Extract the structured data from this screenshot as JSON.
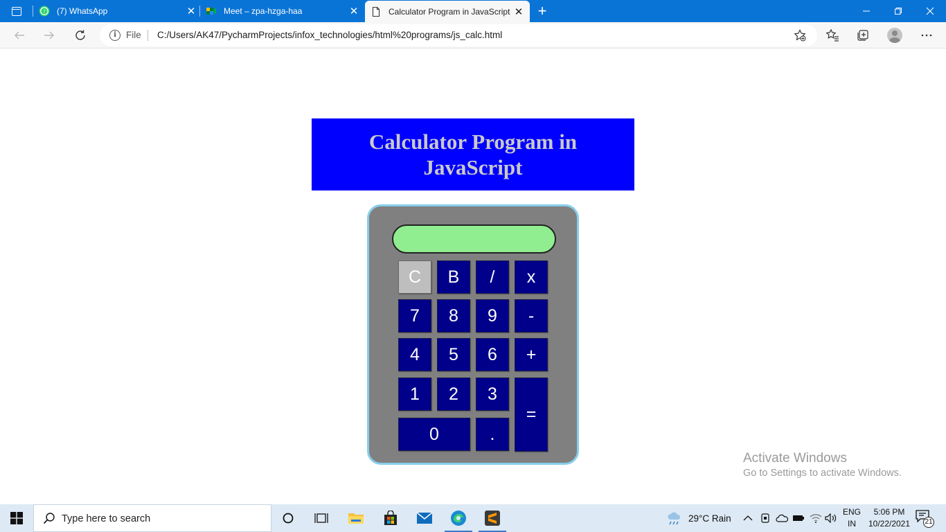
{
  "browser": {
    "tabs": [
      {
        "label": "(7) WhatsApp",
        "favicon": "whatsapp-icon"
      },
      {
        "label": "Meet – zpa-hzga-haa",
        "favicon": "google-meet-icon"
      },
      {
        "label": "Calculator Program in JavaScript",
        "favicon": "page-icon",
        "active": true
      }
    ],
    "address": {
      "scheme_label": "File",
      "url": "C:/Users/AK47/PycharmProjects/infox_technologies/html%20programs/js_calc.html"
    }
  },
  "page": {
    "heading": "Calculator Program in JavaScript",
    "calculator": {
      "display_value": "",
      "keys": {
        "clear": "C",
        "back": "B",
        "divide": "/",
        "multiply": "x",
        "seven": "7",
        "eight": "8",
        "nine": "9",
        "minus": "-",
        "four": "4",
        "five": "5",
        "six": "6",
        "plus": "+",
        "one": "1",
        "two": "2",
        "three": "3",
        "equals": "=",
        "zero": "0",
        "dot": "."
      }
    }
  },
  "watermark": {
    "line1": "Activate Windows",
    "line2": "Go to Settings to activate Windows."
  },
  "taskbar": {
    "search_placeholder": "Type here to search",
    "weather": "29°C  Rain",
    "lang_top": "ENG",
    "lang_bottom": "IN",
    "time": "5:06 PM",
    "date": "10/22/2021",
    "notification_count": "21"
  },
  "colors": {
    "titlebar": "#0a74d6",
    "heading_bg": "#0000ff",
    "heading_text": "#c9c9c9",
    "calc_body": "#808080",
    "calc_border": "#87ceeb",
    "display_bg": "#90ee90",
    "key_bg": "#00008b",
    "clear_key_bg": "#bebebe"
  }
}
